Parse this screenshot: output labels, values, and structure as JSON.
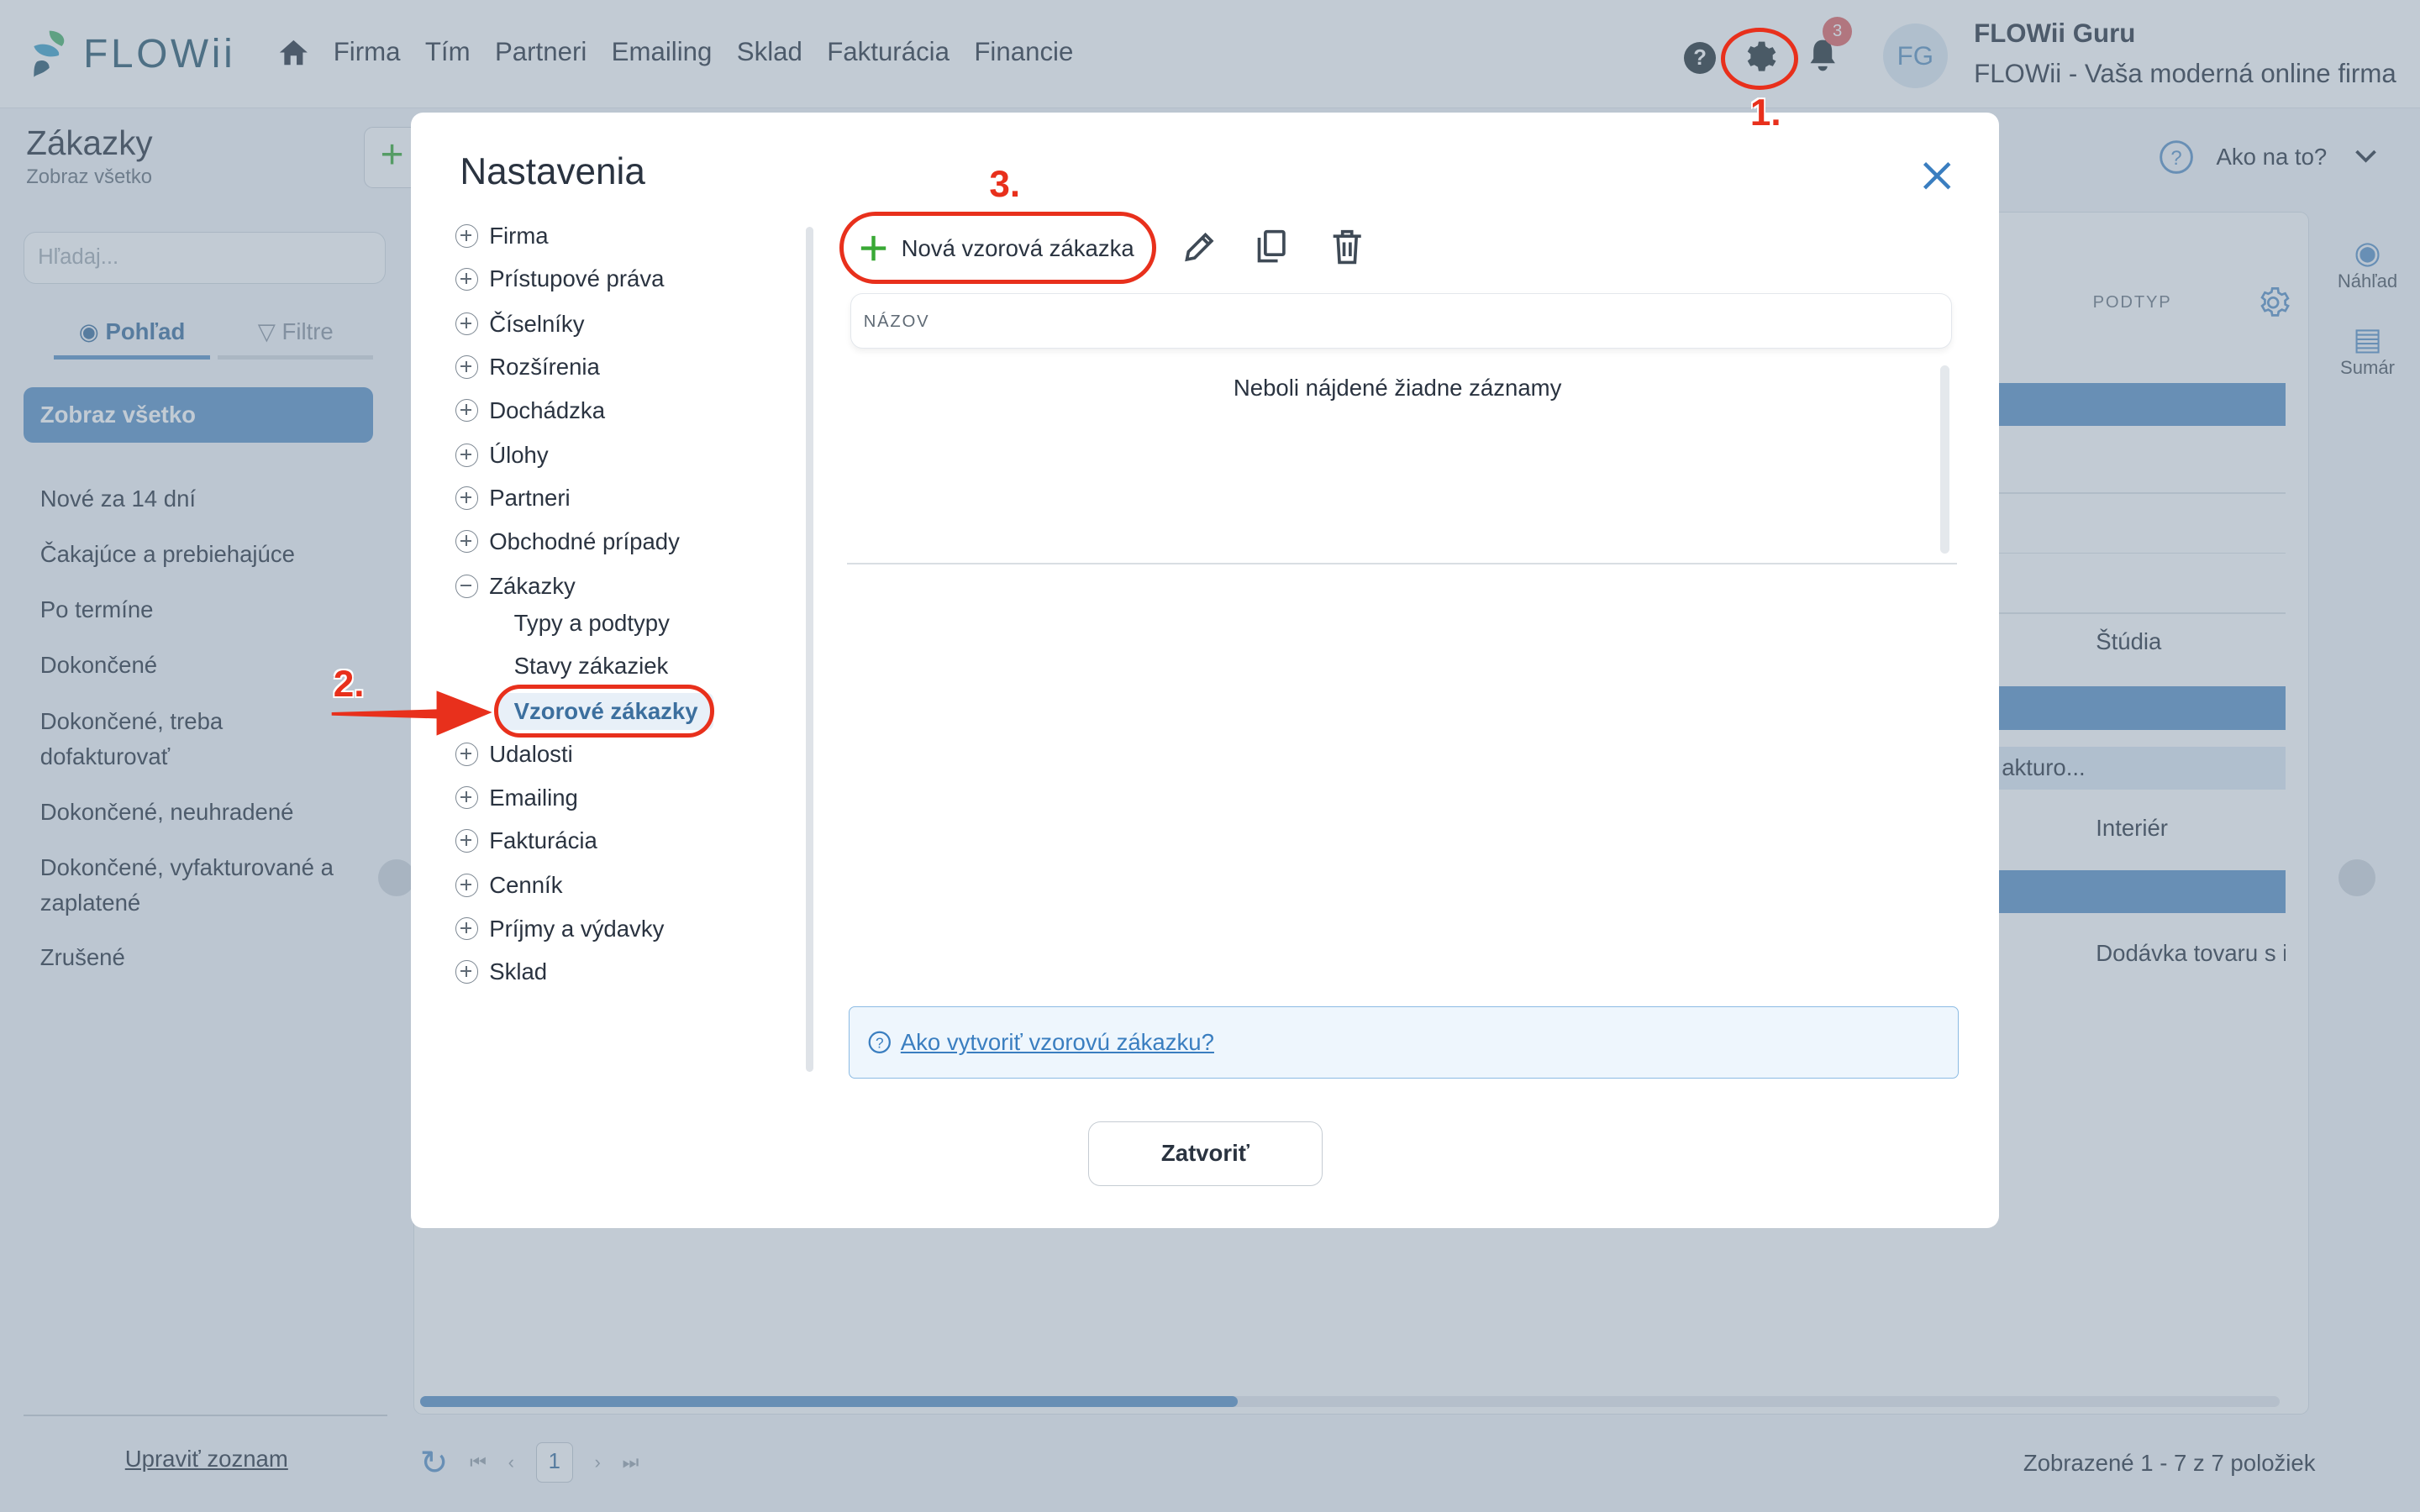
{
  "topnav": {
    "logo_text": "FLOWii",
    "links": [
      "Firma",
      "Tím",
      "Partneri",
      "Emailing",
      "Sklad",
      "Fakturácia",
      "Financie"
    ],
    "help_glyph": "?",
    "notification_count": "3",
    "avatar_initials": "FG",
    "user_name": "FLOWii Guru",
    "user_company": "FLOWii - Vaša moderná online firma"
  },
  "page": {
    "title": "Zákazky",
    "subtitle": "Zobraz všetko",
    "add_glyph": "+",
    "search_placeholder": "Hľadaj...",
    "tabs": {
      "view": "Pohľad",
      "filter": "Filtre"
    },
    "selected_view": "Zobraz všetko",
    "views": [
      "Nové za 14 dní",
      "Čakajúce a prebiehajúce",
      "Po termíne",
      "Dokončené",
      "Dokončené, treba dofakturovať",
      "Dokončené, neuhradené",
      "Dokončené, vyfakturované a zaplatené",
      "Zrušené"
    ],
    "edit_list": "Upraviť zoznam",
    "help_label": "Ako na to?",
    "preview_label": "Náhľad",
    "summary_label": "Sumár",
    "column_podtyp": "PODTYP",
    "cells": [
      "Štúdia",
      "akturo...",
      "Interiér",
      "Dodávka tovaru s i"
    ],
    "page_number": "1",
    "footer_count": "Zobrazené 1 - 7 z 7 položiek"
  },
  "modal": {
    "title": "Nastavenia",
    "tree": [
      "Firma",
      "Prístupové práva",
      "Číselníky",
      "Rozšírenia",
      "Dochádzka",
      "Úlohy",
      "Partneri",
      "Obchodné prípady",
      "Zákazky"
    ],
    "tree_children": [
      "Typy a podtypy",
      "Stavy zákaziek",
      "Vzorové zákazky"
    ],
    "tree_after": [
      "Udalosti",
      "Emailing",
      "Fakturácia",
      "Cenník",
      "Príjmy a výdavky",
      "Sklad"
    ],
    "new_button": "Nová vzorová zákazka",
    "column_name": "NÁZOV",
    "empty_text": "Neboli nájdené žiadne záznamy",
    "info_link": "Ako vytvoriť vzorovú zákazku?",
    "close_button": "Zatvoriť"
  },
  "annotations": {
    "step1": "1.",
    "step2": "2.",
    "step3": "3."
  },
  "colors": {
    "accent": "#5b92c7",
    "annotation": "#e8301c",
    "add_green": "#39a935"
  }
}
